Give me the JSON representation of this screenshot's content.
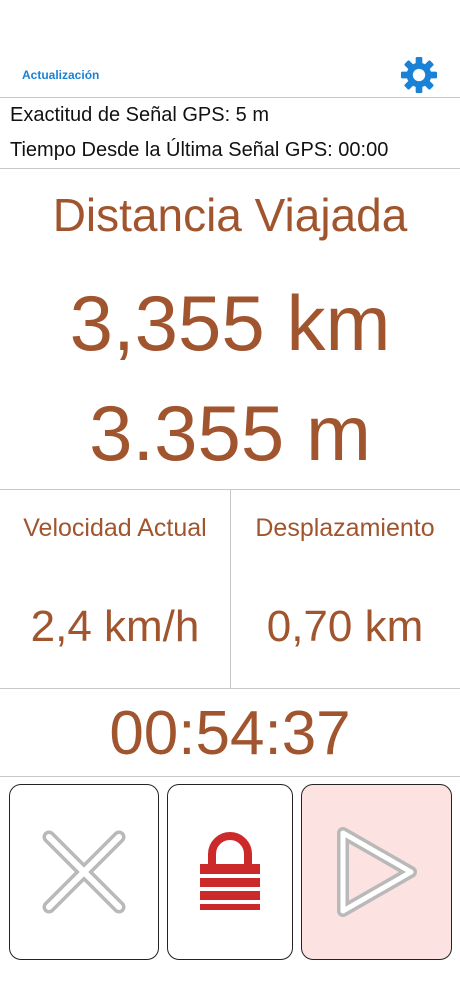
{
  "header": {
    "update_label": "Actualización",
    "settings_icon": "gear-icon"
  },
  "gps": {
    "accuracy": "Exactitud de Señal GPS: 5 m",
    "last_signal": "Tiempo Desde la Última Señal GPS: 00:00"
  },
  "distance": {
    "title": "Distancia Viajada",
    "km": "3,355 km",
    "m": "3.355 m"
  },
  "stats": {
    "speed_label": "Velocidad Actual",
    "speed_value": "2,4 km/h",
    "displacement_label": "Desplazamiento",
    "displacement_value": "0,70 km"
  },
  "timer": "00:54:37",
  "controls": {
    "cancel_icon": "close-icon",
    "lock_icon": "lock-icon",
    "play_icon": "play-icon"
  },
  "colors": {
    "accent": "#a0552e",
    "link": "#1a82d6",
    "lock": "#cc2a2a",
    "play_bg": "#fde2e2"
  }
}
